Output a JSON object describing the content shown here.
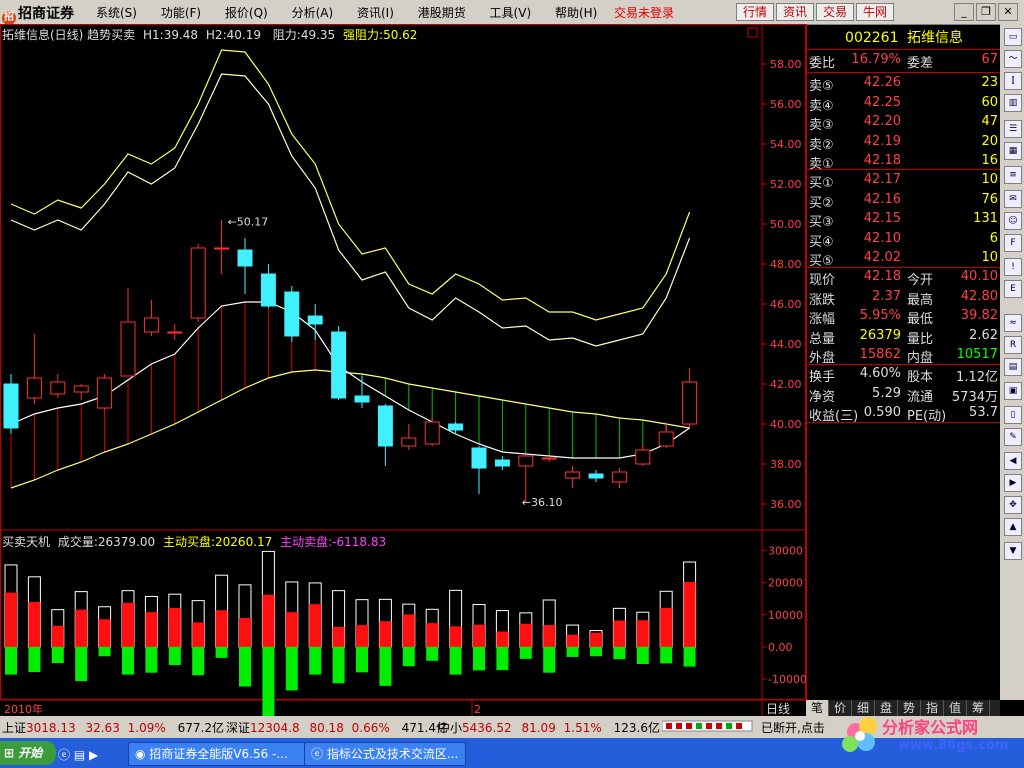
{
  "menubar": {
    "logo": "招商证券",
    "menus": [
      "系统(S)",
      "功能(F)",
      "报价(Q)",
      "分析(A)",
      "资讯(I)",
      "港股期货",
      "工具(V)",
      "帮助(H)"
    ],
    "trade_status": "交易未登录",
    "tabs": [
      "行情",
      "资讯",
      "交易",
      "牛网"
    ]
  },
  "chart": {
    "title": "拓维信息(日线) 趋势买卖",
    "h1": "H1:39.48",
    "h2": "H2:40.19",
    "resist": "阻力:49.35",
    "strong_resist": "强阻力:50.62",
    "high_label": "50.17",
    "low_label": "36.10",
    "year_label": "2010年",
    "month_label": "2",
    "period_button": "日线"
  },
  "volume": {
    "title": "买卖天机",
    "volume": "成交量:26379.00",
    "active_buy": "主动买盘:20260.17",
    "active_sell": "主动卖盘:-6118.83"
  },
  "chart_data": [
    {
      "type": "candlestick",
      "ylim": [
        35,
        59.5
      ],
      "yticks": [
        "58.00",
        "56.00",
        "54.00",
        "52.00",
        "50.00",
        "48.00",
        "46.00",
        "44.00",
        "42.00",
        "40.00",
        "38.00",
        "36.00"
      ],
      "candles": [
        {
          "o": 42.0,
          "c": 39.8,
          "h": 42.5,
          "l": 39.5
        },
        {
          "o": 41.3,
          "c": 42.3,
          "h": 44.5,
          "l": 41.0
        },
        {
          "o": 41.5,
          "c": 42.1,
          "h": 42.5,
          "l": 41.3
        },
        {
          "o": 41.6,
          "c": 41.9,
          "h": 42.0,
          "l": 41.2
        },
        {
          "o": 40.8,
          "c": 42.3,
          "h": 42.5,
          "l": 40.7
        },
        {
          "o": 42.4,
          "c": 45.1,
          "h": 46.8,
          "l": 42.4
        },
        {
          "o": 44.6,
          "c": 45.3,
          "h": 46.2,
          "l": 44.4
        },
        {
          "o": 44.6,
          "c": 44.6,
          "h": 45.0,
          "l": 44.2
        },
        {
          "o": 45.3,
          "c": 48.8,
          "h": 49.0,
          "l": 45.1
        },
        {
          "o": 48.8,
          "c": 48.8,
          "h": 50.2,
          "l": 47.5
        },
        {
          "o": 48.7,
          "c": 47.9,
          "h": 49.3,
          "l": 46.5
        },
        {
          "o": 47.5,
          "c": 45.9,
          "h": 48.0,
          "l": 45.8
        },
        {
          "o": 46.6,
          "c": 44.4,
          "h": 46.9,
          "l": 44.1
        },
        {
          "o": 45.4,
          "c": 45.0,
          "h": 46.0,
          "l": 44.2
        },
        {
          "o": 44.6,
          "c": 41.3,
          "h": 44.9,
          "l": 41.2
        },
        {
          "o": 41.4,
          "c": 41.1,
          "h": 42.4,
          "l": 40.8
        },
        {
          "o": 40.9,
          "c": 38.9,
          "h": 41.0,
          "l": 37.9
        },
        {
          "o": 38.9,
          "c": 39.3,
          "h": 40.0,
          "l": 38.7
        },
        {
          "o": 39.0,
          "c": 40.1,
          "h": 40.3,
          "l": 38.9
        },
        {
          "o": 40.0,
          "c": 39.7,
          "h": 40.1,
          "l": 39.5
        },
        {
          "o": 38.8,
          "c": 37.8,
          "h": 38.9,
          "l": 36.5
        },
        {
          "o": 38.2,
          "c": 37.9,
          "h": 38.4,
          "l": 37.7
        },
        {
          "o": 37.9,
          "c": 38.4,
          "h": 38.5,
          "l": 36.1
        },
        {
          "o": 38.3,
          "c": 38.3,
          "h": 38.4,
          "l": 38.1
        },
        {
          "o": 37.3,
          "c": 37.6,
          "h": 37.9,
          "l": 36.8
        },
        {
          "o": 37.5,
          "c": 37.3,
          "h": 37.7,
          "l": 37.1
        },
        {
          "o": 37.1,
          "c": 37.6,
          "h": 37.8,
          "l": 36.8
        },
        {
          "o": 38.0,
          "c": 38.7,
          "h": 39.0,
          "l": 37.9
        },
        {
          "o": 38.9,
          "c": 39.6,
          "h": 40.1,
          "l": 38.8
        },
        {
          "o": 40.0,
          "c": 42.1,
          "h": 42.8,
          "l": 39.8
        }
      ],
      "upper_band": [
        51.0,
        50.5,
        51.2,
        50.8,
        52.0,
        53.5,
        53.0,
        53.8,
        56.0,
        58.7,
        58.6,
        57.0,
        54.5,
        53.0,
        50.0,
        48.5,
        48.8,
        47.0,
        46.5,
        47.5,
        47.0,
        46.2,
        46.3,
        45.6,
        45.6,
        45.2,
        45.5,
        45.8,
        47.5,
        50.6
      ],
      "lower_band": [
        50.2,
        49.7,
        50.2,
        49.7,
        51.0,
        52.6,
        52.0,
        52.8,
        55.0,
        57.5,
        57.4,
        56.0,
        53.4,
        51.8,
        48.7,
        47.2,
        47.6,
        45.8,
        45.2,
        46.3,
        45.6,
        44.8,
        44.9,
        44.2,
        44.3,
        43.9,
        44.2,
        44.5,
        46.3,
        49.3
      ],
      "ma_short": [
        40.0,
        40.5,
        40.8,
        41.0,
        41.4,
        42.2,
        43.0,
        43.5,
        44.8,
        45.9,
        46.1,
        46.1,
        45.6,
        44.7,
        42.9,
        42.1,
        41.4,
        40.7,
        40.1,
        39.5,
        39.0,
        38.6,
        38.5,
        38.4,
        38.3,
        38.3,
        38.3,
        38.5,
        39.0,
        39.8
      ],
      "ma_long": [
        36.8,
        37.2,
        37.7,
        38.1,
        38.6,
        39.0,
        39.5,
        40.0,
        40.6,
        41.2,
        41.8,
        42.3,
        42.6,
        42.7,
        42.6,
        42.5,
        42.3,
        42.0,
        41.8,
        41.6,
        41.4,
        41.2,
        41.0,
        40.8,
        40.6,
        40.5,
        40.3,
        40.2,
        40.0,
        39.8
      ]
    },
    {
      "type": "bar",
      "ylim": [
        -14000,
        32000
      ],
      "yticks": [
        "30000",
        "20000",
        "10000",
        "0.00",
        "-10000"
      ],
      "total": [
        25500,
        21800,
        11600,
        17200,
        12500,
        17500,
        15700,
        16400,
        14400,
        22300,
        19300,
        29700,
        20200,
        19900,
        17500,
        14700,
        14800,
        13300,
        11700,
        17600,
        13200,
        11300,
        10600,
        14600,
        6800,
        5100,
        12000,
        10800,
        17300,
        26400
      ],
      "buy": [
        16900,
        14000,
        6600,
        11600,
        8600,
        13700,
        10800,
        12100,
        7600,
        11400,
        9000,
        16200,
        10800,
        13300,
        6200,
        6800,
        8000,
        10100,
        7400,
        6400,
        6900,
        4800,
        7200,
        6800,
        3800,
        4400,
        8200,
        8300,
        12100,
        20200
      ],
      "sell": [
        -8600,
        -7800,
        -5000,
        -10600,
        -2900,
        -8600,
        -8000,
        -5600,
        -8800,
        -3400,
        -12300,
        -23400,
        -13500,
        -8600,
        -11300,
        -7900,
        -12100,
        -6000,
        -4300,
        -8600,
        -7300,
        -7200,
        -3700,
        -8000,
        -3100,
        -2900,
        -3800,
        -5300,
        -5100,
        -6100
      ]
    }
  ],
  "quote": {
    "code": "002261",
    "name": "拓维信息",
    "ratio_label": "委比",
    "ratio": "16.79%",
    "diff_label": "委差",
    "diff": "67",
    "asks": [
      {
        "label": "卖⑤",
        "price": "42.26",
        "vol": "23"
      },
      {
        "label": "卖④",
        "price": "42.25",
        "vol": "60"
      },
      {
        "label": "卖③",
        "price": "42.20",
        "vol": "47"
      },
      {
        "label": "卖②",
        "price": "42.19",
        "vol": "20"
      },
      {
        "label": "卖①",
        "price": "42.18",
        "vol": "16"
      }
    ],
    "bids": [
      {
        "label": "买①",
        "price": "42.17",
        "vol": "10"
      },
      {
        "label": "买②",
        "price": "42.16",
        "vol": "76"
      },
      {
        "label": "买③",
        "price": "42.15",
        "vol": "131"
      },
      {
        "label": "买④",
        "price": "42.10",
        "vol": "6"
      },
      {
        "label": "买⑤",
        "price": "42.02",
        "vol": "10"
      }
    ],
    "stats": [
      {
        "l": "现价",
        "v": "42.18",
        "l2": "今开",
        "v2": "40.10",
        "c1": "red",
        "c2": "red"
      },
      {
        "l": "涨跌",
        "v": "2.37",
        "l2": "最高",
        "v2": "42.80",
        "c1": "red",
        "c2": "red"
      },
      {
        "l": "涨幅",
        "v": "5.95%",
        "l2": "最低",
        "v2": "39.82",
        "c1": "red",
        "c2": "red"
      },
      {
        "l": "总量",
        "v": "26379",
        "l2": "量比",
        "v2": "2.62",
        "c1": "yel",
        "c2": "wht"
      },
      {
        "l": "外盘",
        "v": "15862",
        "l2": "内盘",
        "v2": "10517",
        "c1": "red",
        "c2": "grn"
      }
    ],
    "fund": [
      {
        "l": "换手",
        "v": "4.60%",
        "l2": "股本",
        "v2": "1.12亿"
      },
      {
        "l": "净资",
        "v": "5.29",
        "l2": "流通",
        "v2": "5734万"
      },
      {
        "l": "收益(三)",
        "v": "0.590",
        "l2": "PE(动)",
        "v2": "53.7"
      }
    ]
  },
  "bottom_tabs": [
    "笔",
    "价",
    "细",
    "盘",
    "势",
    "指",
    "值",
    "筹"
  ],
  "statusbar": {
    "sh_label": "上证",
    "sh": "3018.13",
    "sh_chg": "32.63",
    "sh_pct": "1.09%",
    "sh_amt": "677.2亿",
    "sz_label": "深证",
    "sz": "12304.8",
    "sz_chg": "80.18",
    "sz_pct": "0.66%",
    "sz_amt": "471.4亿",
    "zx_label": "中小",
    "zx": "5436.52",
    "zx_chg": "81.09",
    "zx_pct": "1.51%",
    "zx_amt": "123.6亿",
    "conn": "已断开,点击"
  },
  "taskbar": {
    "start": "开始",
    "items": [
      "招商证券全能版V6.56 -...",
      "指标公式及技术交流区..."
    ]
  },
  "watermark": {
    "title": "分析家公式网",
    "url": "www.88gs.com"
  }
}
